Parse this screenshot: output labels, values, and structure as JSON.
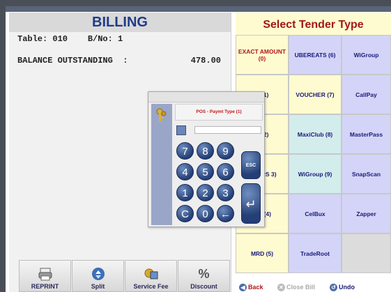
{
  "billing": {
    "title": "BILLING",
    "table_line": "Table: 010    B/No: 1",
    "balance_label": "BALANCE OUTSTANDING  :",
    "balance_amount": "478.00",
    "buttons": {
      "reprint": "REPRINT",
      "split": "Split",
      "service_fee": "Service Fee",
      "discount": "Discount"
    }
  },
  "tender": {
    "title": "Select Tender Type",
    "col1": [
      "EXACT AMOUNT (0)",
      "H (1)",
      "D (2)",
      "OMERS 3)",
      "SIT (4)",
      "MRD (5)"
    ],
    "col2": [
      "UBEREATS (6)",
      "VOUCHER (7)",
      "MaxiClub (8)",
      "WiGroup (9)",
      "CelBux",
      "TradeRoot"
    ],
    "col3": [
      "WiGroup",
      "CallPay",
      "MasterPass",
      "SnapScan",
      "Zapper",
      ""
    ],
    "bottom": {
      "back": "Back",
      "close_bill": "Close Bill",
      "undo": "Undo"
    }
  },
  "popup": {
    "type_label": "POS - Paymt Type (1)",
    "keys": [
      "7",
      "8",
      "9",
      "4",
      "5",
      "6",
      "1",
      "2",
      "3",
      "C",
      "0",
      "←"
    ],
    "esc": "ESC",
    "enter": "↵"
  },
  "icons": {
    "reprint": "printer-icon",
    "split": "split-icon",
    "service_fee": "service-fee-icon",
    "discount": "percent-icon",
    "popup": "keys-icon"
  }
}
